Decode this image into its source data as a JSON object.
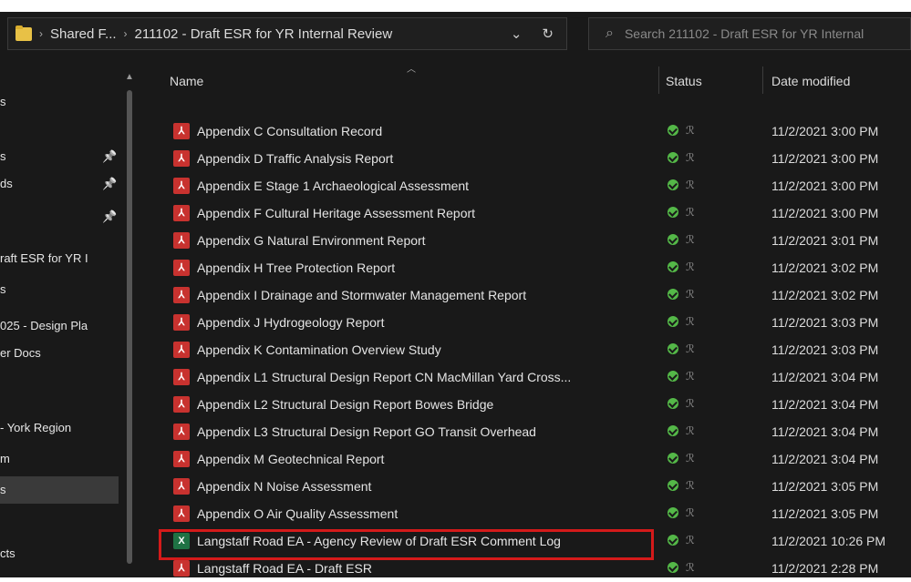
{
  "address": {
    "crumbs": [
      "Shared F...",
      "211102 - Draft ESR for YR Internal Review"
    ],
    "dropdown_icon": "chevron-down",
    "refresh_icon": "refresh"
  },
  "search": {
    "placeholder": "Search 211102 - Draft ESR for YR Internal"
  },
  "nav": {
    "items": [
      {
        "label": "s",
        "pinned": false
      },
      {
        "label": "s",
        "pinned": true
      },
      {
        "label": "ds",
        "pinned": true
      },
      {
        "label": "",
        "pinned": true
      },
      {
        "label": "raft ESR for YR I",
        "pinned": false
      },
      {
        "label": "s",
        "pinned": false
      },
      {
        "label": "025 - Design Pla",
        "pinned": false
      },
      {
        "label": "er Docs",
        "pinned": false
      },
      {
        "label": "",
        "pinned": false
      },
      {
        "label": "",
        "pinned": false
      },
      {
        "label": "- York Region",
        "pinned": false
      },
      {
        "label": "m",
        "pinned": false
      },
      {
        "label": "s",
        "pinned": false
      },
      {
        "label": "",
        "pinned": false
      },
      {
        "label": "cts",
        "pinned": false
      }
    ]
  },
  "columns": {
    "name": "Name",
    "status": "Status",
    "date": "Date modified"
  },
  "files": [
    {
      "name": "Appendix C Consultation Record",
      "type": "pdf",
      "date": "11/2/2021 3:00 PM"
    },
    {
      "name": "Appendix D Traffic Analysis Report",
      "type": "pdf",
      "date": "11/2/2021 3:00 PM"
    },
    {
      "name": "Appendix E Stage 1 Archaeological Assessment",
      "type": "pdf",
      "date": "11/2/2021 3:00 PM"
    },
    {
      "name": "Appendix F Cultural Heritage Assessment Report",
      "type": "pdf",
      "date": "11/2/2021 3:00 PM"
    },
    {
      "name": "Appendix G Natural Environment Report",
      "type": "pdf",
      "date": "11/2/2021 3:01 PM"
    },
    {
      "name": "Appendix H Tree Protection Report",
      "type": "pdf",
      "date": "11/2/2021 3:02 PM"
    },
    {
      "name": "Appendix I Drainage and Stormwater Management Report",
      "type": "pdf",
      "date": "11/2/2021 3:02 PM"
    },
    {
      "name": "Appendix J Hydrogeology Report",
      "type": "pdf",
      "date": "11/2/2021 3:03 PM"
    },
    {
      "name": "Appendix K Contamination Overview Study",
      "type": "pdf",
      "date": "11/2/2021 3:03 PM"
    },
    {
      "name": "Appendix L1 Structural Design Report CN MacMillan Yard Cross...",
      "type": "pdf",
      "date": "11/2/2021 3:04 PM"
    },
    {
      "name": "Appendix L2 Structural Design Report Bowes Bridge",
      "type": "pdf",
      "date": "11/2/2021 3:04 PM"
    },
    {
      "name": "Appendix L3 Structural Design Report GO Transit Overhead",
      "type": "pdf",
      "date": "11/2/2021 3:04 PM"
    },
    {
      "name": "Appendix M Geotechnical Report",
      "type": "pdf",
      "date": "11/2/2021 3:04 PM"
    },
    {
      "name": "Appendix N Noise Assessment",
      "type": "pdf",
      "date": "11/2/2021 3:05 PM"
    },
    {
      "name": "Appendix O Air Quality Assessment",
      "type": "pdf",
      "date": "11/2/2021 3:05 PM"
    },
    {
      "name": "Langstaff Road EA - Agency Review of Draft ESR Comment Log",
      "type": "xlsx",
      "date": "11/2/2021 10:26 PM"
    },
    {
      "name": "Langstaff Road EA - Draft ESR",
      "type": "pdf",
      "date": "11/2/2021 2:28 PM"
    }
  ],
  "highlight_color": "#d41a1a",
  "status_color": "#54b848"
}
